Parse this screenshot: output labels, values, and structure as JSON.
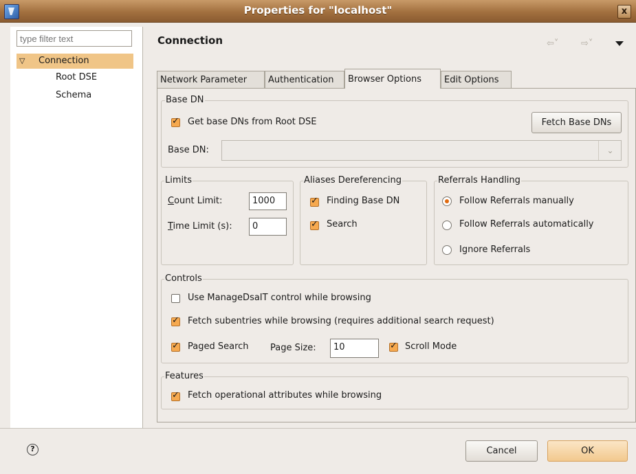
{
  "window": {
    "title": "Properties for \"localhost\"",
    "close_label": "x"
  },
  "sidebar": {
    "filter_placeholder": "type filter text",
    "items": [
      {
        "label": "Connection",
        "expanded": true,
        "selected": true
      },
      {
        "label": "Root DSE"
      },
      {
        "label": "Schema"
      }
    ]
  },
  "header": {
    "title": "Connection",
    "back_icon": "back-arrow-icon",
    "forward_icon": "forward-arrow-icon"
  },
  "tabs": [
    {
      "label": "Network Parameter",
      "active": false
    },
    {
      "label": "Authentication",
      "active": false
    },
    {
      "label": "Browser Options",
      "active": true
    },
    {
      "label": "Edit Options",
      "active": false
    }
  ],
  "base_dn": {
    "group_label": "Base DN",
    "get_from_root_dse_label": "Get base DNs from Root DSE",
    "get_from_root_dse_checked": true,
    "fetch_button": "Fetch Base DNs",
    "field_label": "Base DN:",
    "field_value": ""
  },
  "limits": {
    "group_label": "Limits",
    "count_label": "Count Limit:",
    "count_value": "1000",
    "time_label": "Time Limit (s):",
    "time_value": "0"
  },
  "aliases": {
    "group_label": "Aliases Dereferencing",
    "finding_base_dn_label": "Finding Base DN",
    "finding_base_dn_checked": true,
    "search_label": "Search",
    "search_checked": true
  },
  "referrals": {
    "group_label": "Referrals Handling",
    "options": [
      {
        "label": "Follow Referrals manually",
        "selected": true
      },
      {
        "label": "Follow Referrals automatically",
        "selected": false
      },
      {
        "label": "Ignore Referrals",
        "selected": false
      }
    ]
  },
  "controls": {
    "group_label": "Controls",
    "manage_dsa_it_label": "Use ManageDsaIT control while browsing",
    "manage_dsa_it_checked": false,
    "fetch_subentries_label": "Fetch subentries while browsing (requires additional search request)",
    "fetch_subentries_checked": true,
    "paged_search_label": "Paged Search",
    "paged_search_checked": true,
    "page_size_label": "Page Size:",
    "page_size_value": "10",
    "scroll_mode_label": "Scroll Mode",
    "scroll_mode_checked": true
  },
  "features": {
    "group_label": "Features",
    "fetch_operational_label": "Fetch operational attributes while browsing",
    "fetch_operational_checked": true
  },
  "footer": {
    "help_label": "?",
    "cancel_label": "Cancel",
    "ok_label": "OK"
  },
  "colors": {
    "accent": "#f6a94f",
    "selection": "#f0c587",
    "titlebar": "#a2703f"
  }
}
